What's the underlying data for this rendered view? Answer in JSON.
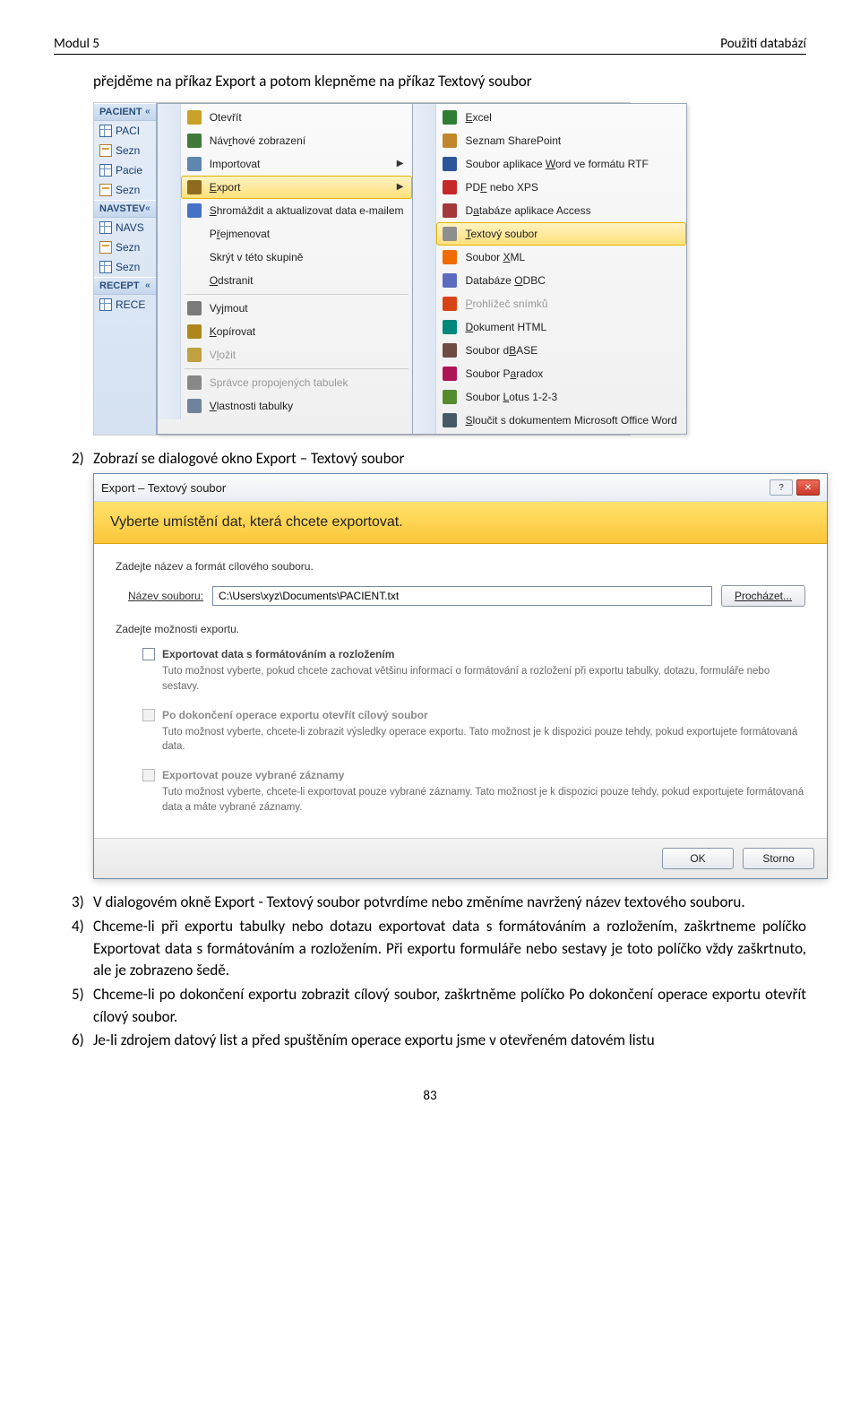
{
  "header": {
    "left": "Modul 5",
    "right": "Použití databází"
  },
  "intro_text": "přejděme na příkaz Export a potom klepněme na příkaz Textový soubor",
  "nav": {
    "groups": [
      {
        "title": "PACIENT",
        "items": [
          "PACI",
          "Sezn",
          "Pacie",
          "Sezn"
        ]
      },
      {
        "title": "NAVSTEV",
        "items": [
          "NAVS",
          "Sezn",
          "Sezn"
        ]
      },
      {
        "title": "RECEPT",
        "items": [
          "RECE"
        ]
      }
    ]
  },
  "menu1": [
    {
      "label": "Otevřít",
      "icon": "c-open"
    },
    {
      "label": "Návrhové zobrazení",
      "icon": "c-design",
      "u": 3
    },
    {
      "label": "Importovat",
      "icon": "c-import",
      "sub": true
    },
    {
      "label": "Export",
      "icon": "c-export",
      "sub": true,
      "hl": true,
      "u": 0
    },
    {
      "label": "Shromáždit a aktualizovat data e-mailem",
      "icon": "c-mail",
      "u": 0
    },
    {
      "label": "Přejmenovat",
      "icon": "",
      "u": 1
    },
    {
      "label": "Skrýt v této skupině",
      "icon": ""
    },
    {
      "label": "Odstranit",
      "icon": "",
      "u": 0
    },
    {
      "sep": true
    },
    {
      "label": "Vyjmout",
      "icon": "c-cut",
      "u": 2
    },
    {
      "label": "Kopírovat",
      "icon": "c-copy",
      "u": 0
    },
    {
      "label": "Vložit",
      "icon": "c-paste",
      "disabled": true,
      "u": 1
    },
    {
      "sep": true
    },
    {
      "label": "Správce propojených tabulek",
      "icon": "c-link",
      "disabled": true
    },
    {
      "label": "Vlastnosti tabulky",
      "icon": "c-prop",
      "u": 0
    }
  ],
  "menu2": [
    {
      "label": "Excel",
      "icon": "c-excel",
      "u": 0
    },
    {
      "label": "Seznam SharePoint",
      "icon": "c-sp"
    },
    {
      "label": "Soubor aplikace Word ve formátu RTF",
      "icon": "c-word",
      "u": 16
    },
    {
      "label": "PDF nebo XPS",
      "icon": "c-pdf",
      "u": 2
    },
    {
      "label": "Databáze aplikace Access",
      "icon": "c-access",
      "u": 1
    },
    {
      "label": "Textový soubor",
      "icon": "c-txt",
      "hl": true,
      "u": 0
    },
    {
      "label": "Soubor XML",
      "icon": "c-xml",
      "u": 7
    },
    {
      "label": "Databáze ODBC",
      "icon": "c-odbc",
      "u": 9
    },
    {
      "label": "Prohlížeč snímků",
      "icon": "c-slide",
      "disabled": true,
      "u": 0
    },
    {
      "label": "Dokument HTML",
      "icon": "c-html",
      "u": 0
    },
    {
      "label": "Soubor dBASE",
      "icon": "c-dbase",
      "u": 8
    },
    {
      "label": "Soubor Paradox",
      "icon": "c-paradox",
      "u": 8
    },
    {
      "label": "Soubor Lotus 1-2-3",
      "icon": "c-lotus",
      "u": 7
    },
    {
      "label": "Sloučit s dokumentem Microsoft Office Word",
      "icon": "c-merge",
      "u": 0
    }
  ],
  "step2": "Zobrazí se dialogové okno Export – Textový soubor",
  "dialog": {
    "title": "Export – Textový soubor",
    "banner": "Vyberte umístění dat, která chcete exportovat.",
    "sub1": "Zadejte název a formát cílového souboru.",
    "file_label": "Název souboru:",
    "file_value": "C:\\Users\\xyz\\Documents\\PACIENT.txt",
    "browse": "Procházet...",
    "sub2": "Zadejte možnosti exportu.",
    "opts": [
      {
        "title": "Exportovat data s formátováním a rozložením",
        "desc": "Tuto možnost vyberte, pokud chcete zachovat většinu informací o formátování a rozložení při exportu tabulky, dotazu, formuláře nebo sestavy.",
        "enabled": true
      },
      {
        "title": "Po dokončení operace exportu otevřít cílový soubor",
        "desc": "Tuto možnost vyberte, chcete-li zobrazit výsledky operace exportu. Tato možnost je k dispozici pouze tehdy, pokud exportujete formátovaná data.",
        "enabled": false
      },
      {
        "title": "Exportovat pouze vybrané záznamy",
        "desc": "Tuto možnost vyberte, chcete-li exportovat pouze vybrané záznamy. Tato možnost je k dispozici pouze tehdy, pokud exportujete formátovaná data a máte vybrané záznamy.",
        "enabled": false
      }
    ],
    "ok": "OK",
    "cancel": "Storno"
  },
  "step3": "V dialogovém okně Export - Textový soubor potvrdíme nebo změníme navržený název textového souboru.",
  "step4": "Chceme-li při exportu tabulky nebo dotazu exportovat data s formátováním a rozložením, zaškrtneme políčko Exportovat data s formátováním a rozložením. Při exportu formuláře nebo sestavy je toto políčko vždy zaškrtnuto, ale je zobrazeno šedě.",
  "step5": "Chceme-li po dokončení exportu zobrazit cílový soubor, zaškrtněme políčko Po dokončení operace exportu otevřít cílový soubor.",
  "step6": "Je-li zdrojem datový list a před spuštěním operace exportu jsme v otevřeném datovém listu",
  "page_num": "83"
}
